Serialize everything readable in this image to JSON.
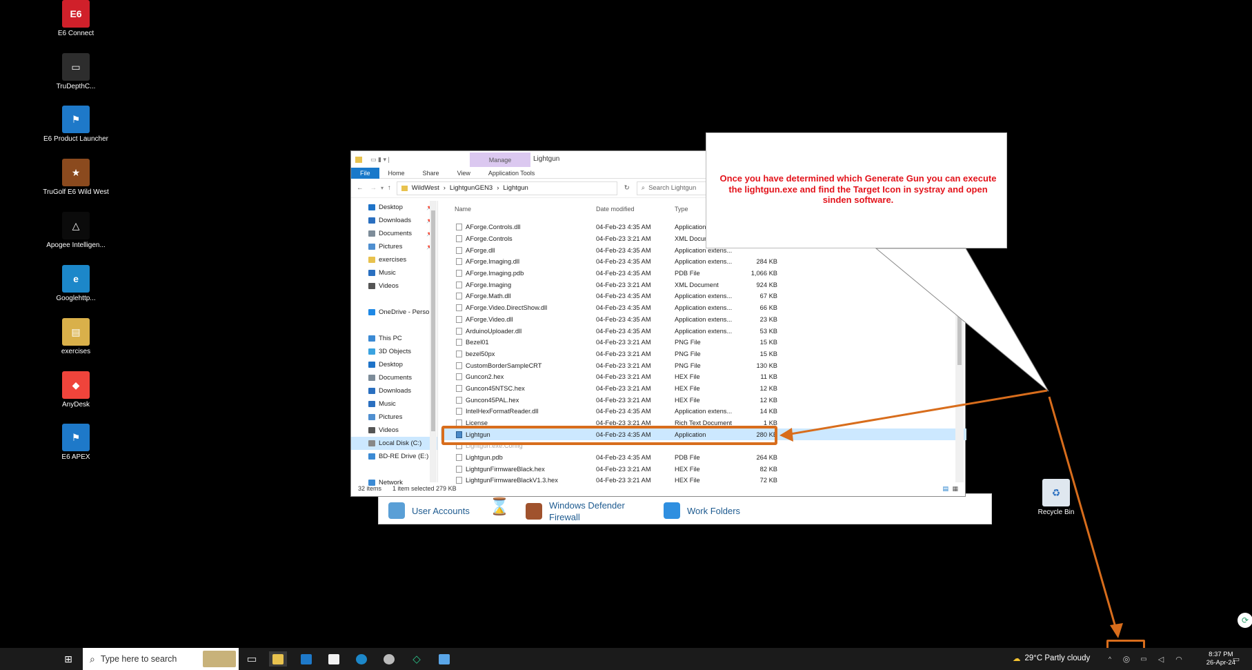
{
  "desktop_icons": [
    {
      "label": "E6 Connect",
      "color": "#d0202a",
      "glyph": "E6"
    },
    {
      "label": "TruDepthC...",
      "color": "#2d2d2d",
      "glyph": "▭"
    },
    {
      "label": "E6 Product Launcher",
      "color": "#1e79c9",
      "glyph": "⚑"
    },
    {
      "label": "TruGolf E6 Wild West",
      "color": "#8b4a1e",
      "glyph": "★"
    },
    {
      "label": "Apogee Intelligen...",
      "color": "#0b0b0b",
      "glyph": "△"
    },
    {
      "label": "Googlehttp...",
      "color": "#1c87c9",
      "glyph": "e"
    },
    {
      "label": "exercises",
      "color": "#d9b04a",
      "glyph": "▤"
    },
    {
      "label": "AnyDesk",
      "color": "#ef443b",
      "glyph": "◆"
    },
    {
      "label": "E6 APEX",
      "color": "#1e79c9",
      "glyph": "⚑"
    }
  ],
  "recycle_bin": {
    "label": "Recycle Bin"
  },
  "control_panel": {
    "items": [
      {
        "label": "User Accounts"
      },
      {
        "label": "Windows Defender Firewall"
      },
      {
        "label": "Work Folders"
      }
    ]
  },
  "explorer": {
    "title": "Lightgun",
    "manage_tab": "Manage",
    "ribbon_tabs": [
      "File",
      "Home",
      "Share",
      "View",
      "Application Tools"
    ],
    "breadcrumb": [
      "WildWest",
      "LightgunGEN3",
      "Lightgun"
    ],
    "search_placeholder": "Search Lightgun",
    "columns": {
      "name": "Name",
      "date": "Date modified",
      "type": "Type",
      "size": ""
    },
    "nav_items": [
      {
        "label": "Desktop",
        "pinned": true,
        "color": "#1e73c8"
      },
      {
        "label": "Downloads",
        "pinned": true,
        "color": "#2a6fc0"
      },
      {
        "label": "Documents",
        "pinned": true,
        "color": "#7d8c99"
      },
      {
        "label": "Pictures",
        "pinned": true,
        "color": "#4f8fd0"
      },
      {
        "label": "exercises",
        "pinned": false,
        "color": "#e8c24e"
      },
      {
        "label": "Music",
        "pinned": false,
        "color": "#2a6fc0"
      },
      {
        "label": "Videos",
        "pinned": false,
        "color": "#555"
      },
      {
        "label": "",
        "pinned": false,
        "color": ""
      },
      {
        "label": "OneDrive - Person",
        "pinned": false,
        "color": "#1e88e5"
      },
      {
        "label": "",
        "pinned": false,
        "color": ""
      },
      {
        "label": "This PC",
        "pinned": false,
        "color": "#3b8ad4"
      },
      {
        "label": "3D Objects",
        "pinned": false,
        "color": "#3aa3e0"
      },
      {
        "label": "Desktop",
        "pinned": false,
        "color": "#1e73c8"
      },
      {
        "label": "Documents",
        "pinned": false,
        "color": "#7d8c99"
      },
      {
        "label": "Downloads",
        "pinned": false,
        "color": "#2a6fc0"
      },
      {
        "label": "Music",
        "pinned": false,
        "color": "#2a6fc0"
      },
      {
        "label": "Pictures",
        "pinned": false,
        "color": "#4f8fd0"
      },
      {
        "label": "Videos",
        "pinned": false,
        "color": "#555"
      },
      {
        "label": "Local Disk (C:)",
        "pinned": false,
        "color": "#888",
        "selected": true
      },
      {
        "label": "BD-RE Drive (E:)",
        "pinned": false,
        "color": "#3b8ad4"
      },
      {
        "label": "",
        "pinned": false,
        "color": ""
      },
      {
        "label": "Network",
        "pinned": false,
        "color": "#3b8ad4"
      }
    ],
    "files": [
      {
        "name": "AForge.Controls.dll",
        "date": "04-Feb-23 4:35 AM",
        "type": "Application e",
        "size": ""
      },
      {
        "name": "AForge.Controls",
        "date": "04-Feb-23 3:21 AM",
        "type": "XML Docume",
        "size": ""
      },
      {
        "name": "AForge.dll",
        "date": "04-Feb-23 4:35 AM",
        "type": "Application extens...",
        "size": ""
      },
      {
        "name": "AForge.Imaging.dll",
        "date": "04-Feb-23 4:35 AM",
        "type": "Application extens...",
        "size": "284 KB"
      },
      {
        "name": "AForge.Imaging.pdb",
        "date": "04-Feb-23 4:35 AM",
        "type": "PDB File",
        "size": "1,066 KB"
      },
      {
        "name": "AForge.Imaging",
        "date": "04-Feb-23 3:21 AM",
        "type": "XML Document",
        "size": "924 KB"
      },
      {
        "name": "AForge.Math.dll",
        "date": "04-Feb-23 4:35 AM",
        "type": "Application extens...",
        "size": "67 KB"
      },
      {
        "name": "AForge.Video.DirectShow.dll",
        "date": "04-Feb-23 4:35 AM",
        "type": "Application extens...",
        "size": "66 KB"
      },
      {
        "name": "AForge.Video.dll",
        "date": "04-Feb-23 4:35 AM",
        "type": "Application extens...",
        "size": "23 KB"
      },
      {
        "name": "ArduinoUploader.dll",
        "date": "04-Feb-23 4:35 AM",
        "type": "Application extens...",
        "size": "53 KB"
      },
      {
        "name": "Bezel01",
        "date": "04-Feb-23 3:21 AM",
        "type": "PNG File",
        "size": "15 KB"
      },
      {
        "name": "bezel50px",
        "date": "04-Feb-23 3:21 AM",
        "type": "PNG File",
        "size": "15 KB"
      },
      {
        "name": "CustomBorderSampleCRT",
        "date": "04-Feb-23 3:21 AM",
        "type": "PNG File",
        "size": "130 KB"
      },
      {
        "name": "Guncon2.hex",
        "date": "04-Feb-23 3:21 AM",
        "type": "HEX File",
        "size": "11 KB"
      },
      {
        "name": "Guncon45NTSC.hex",
        "date": "04-Feb-23 3:21 AM",
        "type": "HEX File",
        "size": "12 KB"
      },
      {
        "name": "Guncon45PAL.hex",
        "date": "04-Feb-23 3:21 AM",
        "type": "HEX File",
        "size": "12 KB"
      },
      {
        "name": "IntelHexFormatReader.dll",
        "date": "04-Feb-23 4:35 AM",
        "type": "Application extens...",
        "size": "14 KB"
      },
      {
        "name": "License",
        "date": "04-Feb-23 3:21 AM",
        "type": "Rich Text Document",
        "size": "1 KB"
      },
      {
        "name": "Lightgun",
        "date": "04-Feb-23 4:35 AM",
        "type": "Application",
        "size": "280 KB",
        "selected": true
      },
      {
        "name": "Lightgun.exe.Config",
        "date": "",
        "type": "",
        "size": ""
      },
      {
        "name": "Lightgun.pdb",
        "date": "04-Feb-23 4:35 AM",
        "type": "PDB File",
        "size": "264 KB"
      },
      {
        "name": "LightgunFirmwareBlack.hex",
        "date": "04-Feb-23 3:21 AM",
        "type": "HEX File",
        "size": "82 KB"
      },
      {
        "name": "LightgunFirmwareBlackV1.3.hex",
        "date": "04-Feb-23 3:21 AM",
        "type": "HEX File",
        "size": "72 KB"
      }
    ],
    "status_count": "32 items",
    "status_selected": "1 item selected  279 KB"
  },
  "callout": {
    "text": "Once you have determined which Generate Gun you can execute the lightgun.exe and find the Target Icon in systray and open sinden software."
  },
  "taskbar": {
    "search_placeholder": "Type here to search",
    "weather": "29°C  Partly cloudy",
    "time": "8:37 PM",
    "date": "26-Apr-24"
  },
  "colors": {
    "highlight": "#d86d1c",
    "callout_text": "#e3131b",
    "selection": "#cce8ff"
  }
}
